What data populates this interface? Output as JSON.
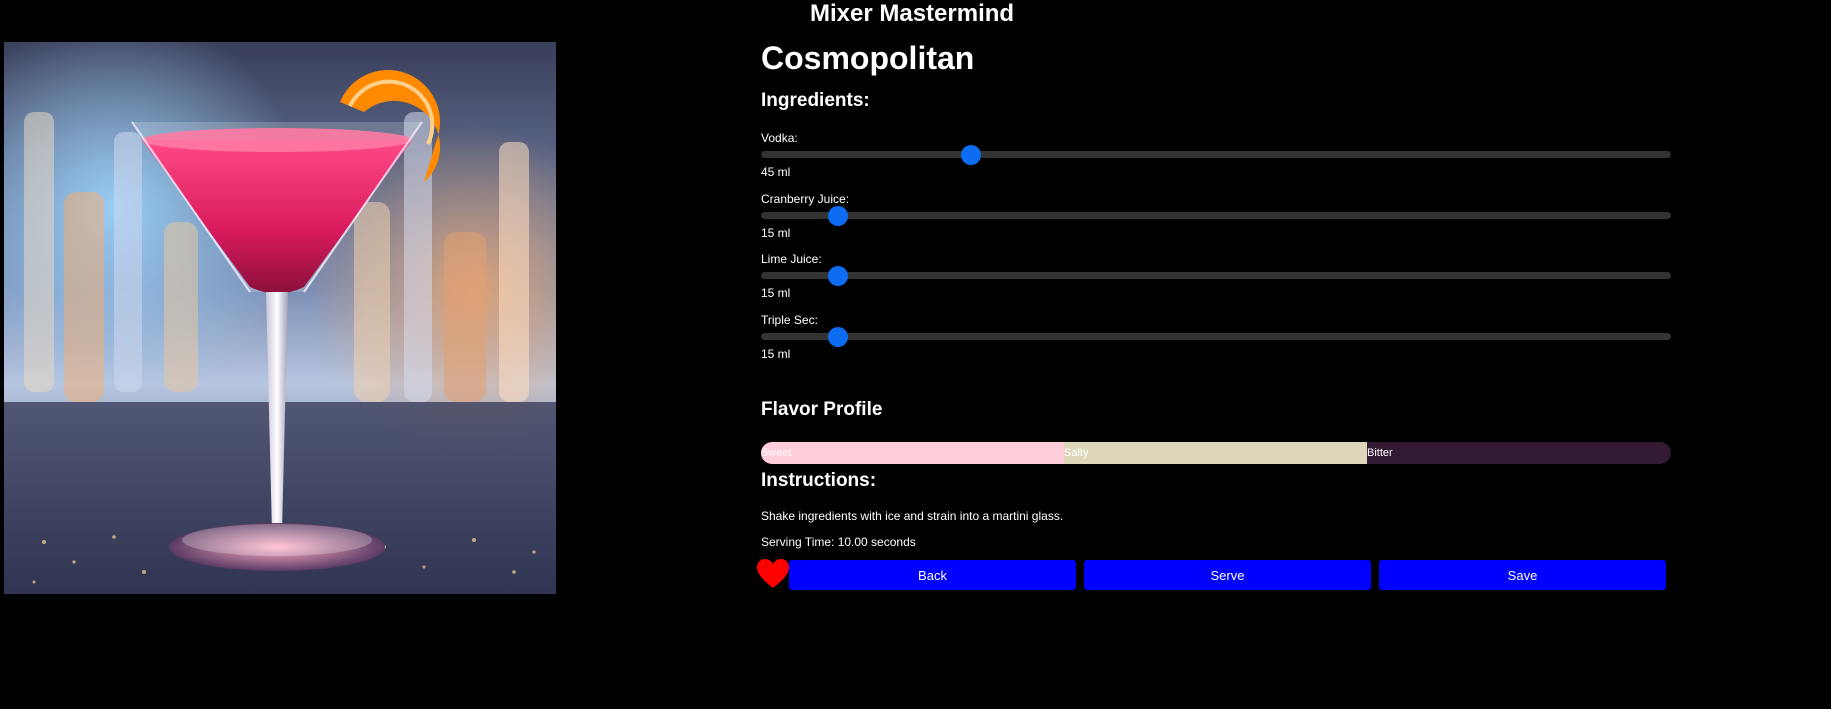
{
  "app": {
    "title": "Mixer Mastermind"
  },
  "drink": {
    "name": "Cosmopolitan",
    "image_icon": "cosmopolitan-cocktail-photo"
  },
  "ingredients": {
    "heading": "Ingredients:",
    "items": [
      {
        "label": "Vodka:",
        "amount": "45 ml",
        "value": 45,
        "max": 200
      },
      {
        "label": "Cranberry Juice:",
        "amount": "15 ml",
        "value": 15,
        "max": 200
      },
      {
        "label": "Lime Juice:",
        "amount": "15 ml",
        "value": 15,
        "max": 200
      },
      {
        "label": "Triple Sec:",
        "amount": "15 ml",
        "value": 15,
        "max": 200
      }
    ]
  },
  "flavor": {
    "heading": "Flavor Profile",
    "segments": [
      {
        "label": "Sweet",
        "fraction": 0.333,
        "color": "#ffccd9",
        "text_color": "#ffffff"
      },
      {
        "label": "Salty",
        "fraction": 0.333,
        "color": "#ddd6bb",
        "text_color": "#ffffff"
      },
      {
        "label": "Bitter",
        "fraction": 0.334,
        "color": "#321a33",
        "text_color": "#ffffff"
      }
    ]
  },
  "instructions": {
    "heading": "Instructions:",
    "text": "Shake ingredients with ice and strain into a martini glass.",
    "serving_time": "Serving Time: 10.00 seconds"
  },
  "actions": {
    "favorite_icon": "heart-icon",
    "favorite_color": "#ff0000",
    "back_label": "Back",
    "serve_label": "Serve",
    "save_label": "Save",
    "button_color": "#0000ff"
  },
  "colors": {
    "background": "#000000",
    "slider_thumb": "#0c6cf2",
    "slider_track": "#333333"
  }
}
